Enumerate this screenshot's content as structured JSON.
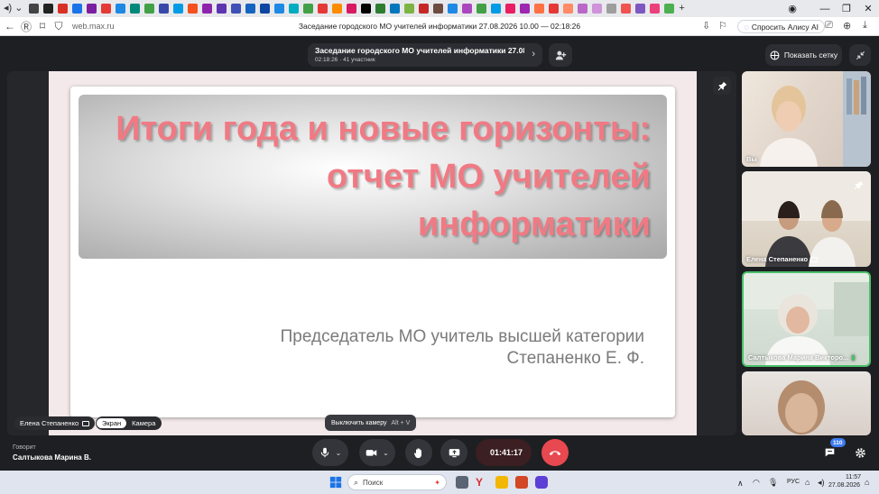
{
  "browser": {
    "url": "web.max.ru",
    "tab_title": "Заседание городского МО учителей информатики 27.08.2026 10.00 — 02:18:26",
    "alice_label": "Спросить Алису AI",
    "favicon_colors": [
      "#444",
      "#222",
      "#d93025",
      "#1a73e8",
      "#7b1fa2",
      "#e53935",
      "#1e88e5",
      "#00897b",
      "#43a047",
      "#3949ab",
      "#039be5",
      "#f4511e",
      "#8e24aa",
      "#5e35b1",
      "#3f51b5",
      "#1565c0",
      "#0d47a1",
      "#1e88e5",
      "#00acc1",
      "#43a047",
      "#e53935",
      "#fb8c00",
      "#d81b60",
      "#000000",
      "#2e7d32",
      "#0277bd",
      "#7cb342",
      "#c62828",
      "#6d4c41",
      "#1e88e5",
      "#ab47bc",
      "#43a047",
      "#039be5",
      "#e91e63",
      "#9c27b0",
      "#ff7043",
      "#e53935",
      "#ff8a65",
      "#ba68c8",
      "#ce93d8",
      "#9e9e9e",
      "#ef5350",
      "#7e57c2",
      "#ec407a",
      "#4caf50"
    ]
  },
  "meeting": {
    "title": "Заседание городского МО учителей информатики 27.08...",
    "subtitle": "02:18:26 · 41 участник",
    "grid_label": "Показать сетку"
  },
  "slide": {
    "title": "Итоги года и новые горизонты: отчет МО учителей информатики",
    "subtitle_line1": "Председатель МО учитель высшей категории",
    "subtitle_line2": "Степаненко Е. Ф."
  },
  "stage": {
    "presenter_label": "Елена Степаненко",
    "switch_screen": "Экран",
    "switch_camera": "Камера",
    "tooltip_text": "Выключить камеру",
    "tooltip_kbd": "Alt + V"
  },
  "participants": [
    {
      "name": "Вы"
    },
    {
      "name": "Елена Степаненко"
    },
    {
      "name": "Салтыкова Марина Викторо..."
    },
    {
      "name": ""
    }
  ],
  "controls": {
    "speaking_caption": "Говорит",
    "speaking_name": "Салтыкова Марина В.",
    "timer": "01:41:17",
    "chat_count": "110"
  },
  "taskbar": {
    "search_placeholder": "Поиск",
    "lang": "РУС",
    "time": "11:57",
    "date": "27.08.2026"
  },
  "colors": {
    "accent_red": "#e8484f",
    "slide_title": "#f07a84",
    "badge_blue": "#3d7bf2"
  }
}
